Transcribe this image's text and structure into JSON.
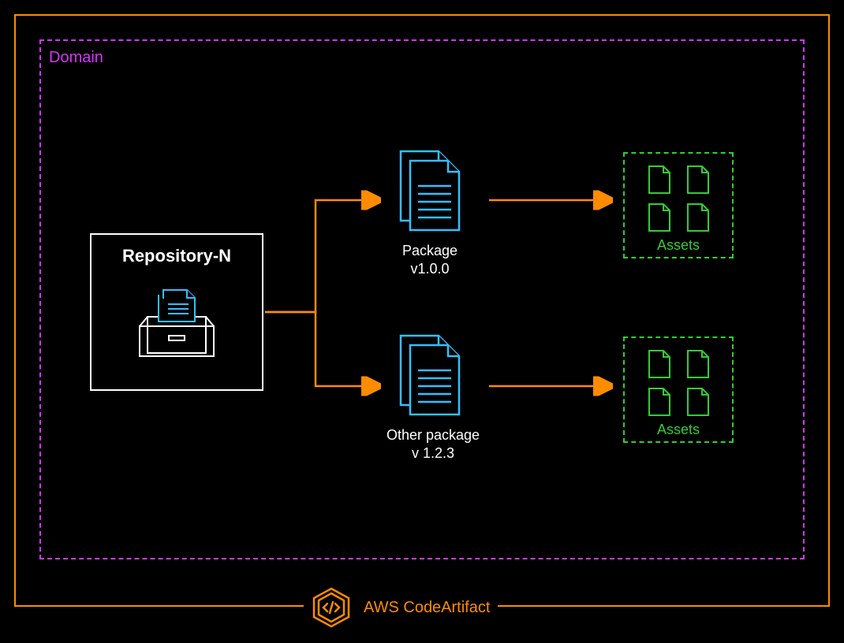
{
  "domain": {
    "label": "Domain"
  },
  "repository": {
    "label": "Repository-N"
  },
  "packages": [
    {
      "name": "Package",
      "version": "v1.0.0"
    },
    {
      "name": "Other package",
      "version": "v 1.2.3"
    }
  ],
  "assets": {
    "label": "Assets"
  },
  "service": {
    "label": "AWS CodeArtifact"
  }
}
